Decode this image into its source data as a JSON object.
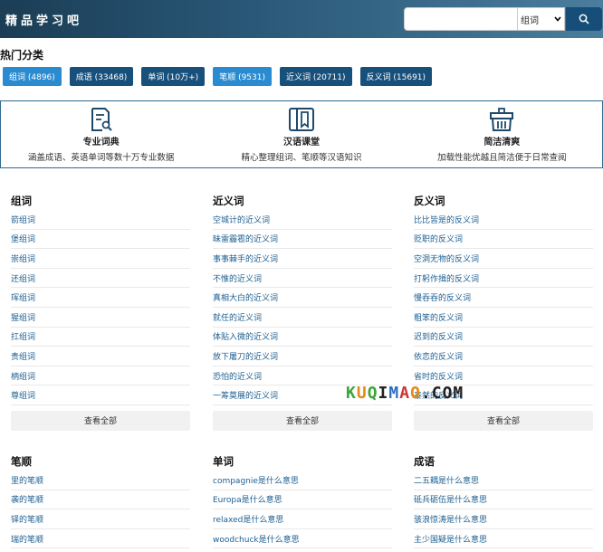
{
  "header": {
    "logo": "精品学习吧",
    "search_placeholder": "",
    "select_value": "组词"
  },
  "hot": {
    "title": "热门分类",
    "tags": [
      {
        "label": "组词 (4896)",
        "style": "light"
      },
      {
        "label": "成语 (33468)",
        "style": "dark"
      },
      {
        "label": "单词 (10万+)",
        "style": "dark"
      },
      {
        "label": "笔顺 (9531)",
        "style": "light"
      },
      {
        "label": "近义词 (20711)",
        "style": "dark"
      },
      {
        "label": "反义词 (15691)",
        "style": "dark"
      }
    ]
  },
  "features": [
    {
      "icon": "dictionary-search-icon",
      "title": "专业词典",
      "desc": "涵盖成语、英语单词等数十万专业数据"
    },
    {
      "icon": "book-icon",
      "title": "汉语课堂",
      "desc": "精心整理组词、笔顺等汉语知识"
    },
    {
      "icon": "basket-icon",
      "title": "简洁清爽",
      "desc": "加载性能优越且简洁便于日常查阅"
    }
  ],
  "columns": [
    {
      "title": "组词",
      "items": [
        "箭组词",
        "堡组词",
        "崇组词",
        "还组词",
        "珲组词",
        "猩组词",
        "扛组词",
        "贵组词",
        "柄组词",
        "尊组词"
      ],
      "more": "查看全部"
    },
    {
      "title": "近义词",
      "items": [
        "空城计的近义词",
        "昧雷霾雹的近义词",
        "事事棘手的近义词",
        "不惟的近义词",
        "真相大白的近义词",
        "就任的近义词",
        "体贴入微的近义词",
        "放下屠刀的近义词",
        "恐怕的近义词",
        "一筹莫展的近义词"
      ],
      "more": "查看全部"
    },
    {
      "title": "反义词",
      "items": [
        "比比皆是的反义词",
        "贬职的反义词",
        "空洞无物的反义词",
        "打躬作揖的反义词",
        "慢吞吞的反义词",
        "粗笨的反义词",
        "迟到的反义词",
        "依恋的反义词",
        "省时的反义词",
        "泰然的反义词"
      ],
      "more": "查看全部"
    },
    {
      "title": "笔顺",
      "items": [
        "里的笔顺",
        "袭的笔顺",
        "铎的笔顺",
        "瑞的笔顺"
      ]
    },
    {
      "title": "单词",
      "items": [
        "compagnie是什么意思",
        "Europa是什么意思",
        "relaxed是什么意思",
        "woodchuck是什么意思"
      ]
    },
    {
      "title": "成语",
      "items": [
        "二五耦是什么意思",
        "砥兵砺伍是什么意思",
        "骇浪惊涛是什么意思",
        "主少国疑是什么意思"
      ]
    }
  ],
  "watermark": {
    "p1": "K",
    "p2": "U",
    "p3": "Q",
    "p4": "I",
    "p5": "M",
    "p6": "A",
    "p7": "O",
    "p8": ".COM"
  }
}
